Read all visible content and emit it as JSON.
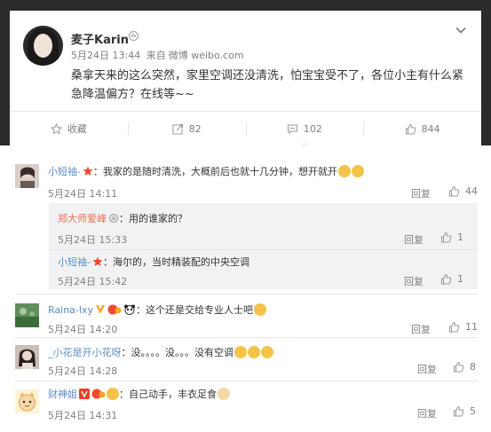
{
  "post": {
    "user_name": "麦子Karin",
    "time": "5月24日 13:44",
    "source_prefix": "来自",
    "source": "微博 weibo.com",
    "text": "桑拿天来的这么突然，家里空调还没清洗，怕宝宝受不了，各位小主有什么紧急降温偏方？在线等~~",
    "actions": {
      "favorite_label": "收藏",
      "repost_count": "82",
      "comment_count": "102",
      "like_count": "844"
    }
  },
  "comments": [
    {
      "user": "小短袖-",
      "text": "：我家的是随时清洗，大概前后也就十几分钟，想开就开",
      "time": "5月24日 14:11",
      "reply_label": "回复",
      "likes": "44",
      "replies": [
        {
          "user": "郑大师爱峰",
          "text": "：用的谁家的？",
          "time": "5月24日 15:33",
          "reply_label": "回复",
          "likes": "1"
        },
        {
          "user": "小短袖-",
          "text": "：海尔的，当时精装配的中央空调",
          "time": "5月24日 15:42",
          "reply_label": "回复",
          "likes": "1"
        }
      ]
    },
    {
      "user": "Raina-lxy",
      "text": "：这个还是交给专业人士吧",
      "time": "5月24日 14:20",
      "reply_label": "回复",
      "likes": "11"
    },
    {
      "user": "_小花是开小花呀",
      "text": "：没。。。。没。。。没有空调",
      "time": "5月24日 14:28",
      "reply_label": "回复",
      "likes": "8"
    },
    {
      "user": "财神姐",
      "text": "：自己动手，丰衣足食",
      "time": "5月24日 14:31",
      "reply_label": "回复",
      "likes": "5"
    }
  ],
  "colors": {
    "accent": "#eb7350",
    "link": "#5a8dc8",
    "muted": "#808080",
    "top_background": "#2b2b2b"
  }
}
